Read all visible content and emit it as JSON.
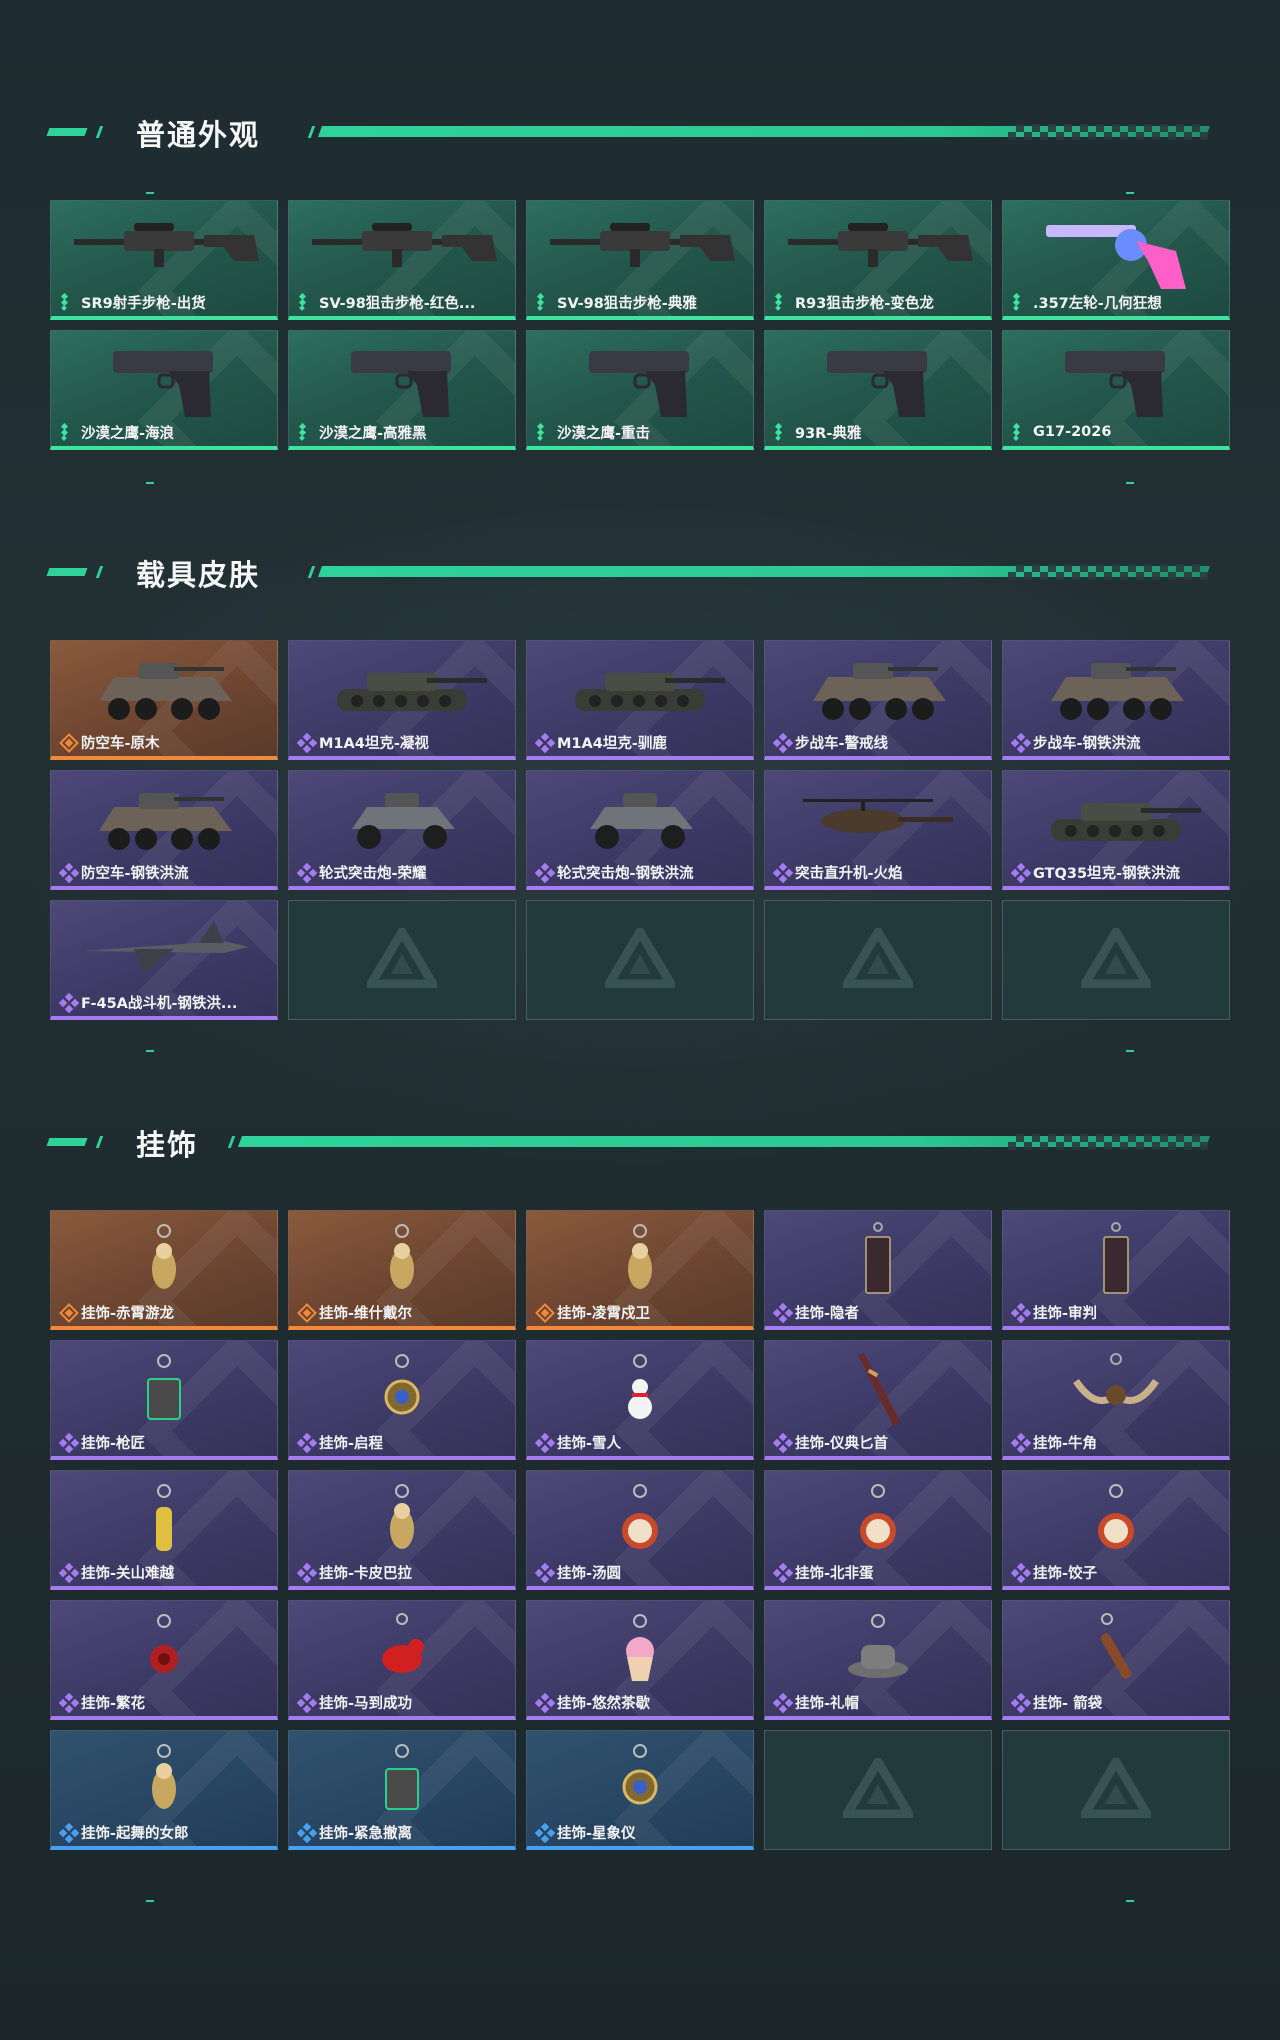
{
  "sections": {
    "weapon": {
      "title": "普通外观",
      "items": [
        {
          "label": "SR9射手步枪-出货",
          "icon": "sniper-rifle-icon"
        },
        {
          "label": "SV-98狙击步枪-红色...",
          "icon": "sniper-rifle-icon"
        },
        {
          "label": "SV-98狙击步枪-典雅",
          "icon": "sniper-rifle-icon"
        },
        {
          "label": "R93狙击步枪-变色龙",
          "icon": "sniper-rifle-icon"
        },
        {
          "label": ".357左轮-几何狂想",
          "icon": "revolver-icon"
        },
        {
          "label": "沙漠之鹰-海浪",
          "icon": "pistol-icon"
        },
        {
          "label": "沙漠之鹰-高雅黑",
          "icon": "pistol-icon"
        },
        {
          "label": "沙漠之鹰-重击",
          "icon": "pistol-icon"
        },
        {
          "label": "93R-典雅",
          "icon": "pistol-icon"
        },
        {
          "label": "G17-2026",
          "icon": "pistol-icon"
        }
      ]
    },
    "vehicle": {
      "title": "载具皮肤",
      "items": [
        {
          "label": "防空车-原木",
          "rarity": "gold",
          "icon": "armored-vehicle-icon"
        },
        {
          "label": "M1A4坦克-凝视",
          "rarity": "purple",
          "icon": "tank-icon"
        },
        {
          "label": "M1A4坦克-驯鹿",
          "rarity": "purple",
          "icon": "tank-icon"
        },
        {
          "label": "步战车-警戒线",
          "rarity": "purple",
          "icon": "armored-vehicle-icon"
        },
        {
          "label": "步战车-钢铁洪流",
          "rarity": "purple",
          "icon": "armored-vehicle-icon"
        },
        {
          "label": "防空车-钢铁洪流",
          "rarity": "purple",
          "icon": "armored-vehicle-icon"
        },
        {
          "label": "轮式突击炮-荣耀",
          "rarity": "purple",
          "icon": "buggy-icon"
        },
        {
          "label": "轮式突击炮-钢铁洪流",
          "rarity": "purple",
          "icon": "buggy-icon"
        },
        {
          "label": "突击直升机-火焰",
          "rarity": "purple",
          "icon": "helicopter-icon"
        },
        {
          "label": "GTQ35坦克-钢铁洪流",
          "rarity": "purple",
          "icon": "tank-icon"
        },
        {
          "label": "F-45A战斗机-钢铁洪...",
          "rarity": "purple",
          "icon": "jet-icon"
        }
      ]
    },
    "charm": {
      "title": "挂饰",
      "items": [
        {
          "label": "挂饰-赤霄游龙",
          "rarity": "gold",
          "icon": "charm-figure-icon"
        },
        {
          "label": "挂饰-维什戴尔",
          "rarity": "gold",
          "icon": "charm-figure-icon"
        },
        {
          "label": "挂饰-凌霄戍卫",
          "rarity": "gold",
          "icon": "charm-figure-icon"
        },
        {
          "label": "挂饰-隐者",
          "rarity": "purple",
          "icon": "charm-card-icon"
        },
        {
          "label": "挂饰-审判",
          "rarity": "purple",
          "icon": "charm-card-icon"
        },
        {
          "label": "挂饰-枪匠",
          "rarity": "purple",
          "icon": "charm-box-icon"
        },
        {
          "label": "挂饰-启程",
          "rarity": "purple",
          "icon": "charm-medal-icon"
        },
        {
          "label": "挂饰-雪人",
          "rarity": "purple",
          "icon": "charm-snowman-icon"
        },
        {
          "label": "挂饰-仪典匕首",
          "rarity": "purple",
          "icon": "charm-dagger-icon"
        },
        {
          "label": "挂饰-牛角",
          "rarity": "purple",
          "icon": "charm-horns-icon"
        },
        {
          "label": "挂饰-关山难越",
          "rarity": "purple",
          "icon": "charm-scroll-icon"
        },
        {
          "label": "挂饰-卡皮巴拉",
          "rarity": "purple",
          "icon": "charm-figure-icon"
        },
        {
          "label": "挂饰-汤圆",
          "rarity": "purple",
          "icon": "charm-bowl-icon"
        },
        {
          "label": "挂饰-北非蛋",
          "rarity": "purple",
          "icon": "charm-bowl-icon"
        },
        {
          "label": "挂饰-饺子",
          "rarity": "purple",
          "icon": "charm-bowl-icon"
        },
        {
          "label": "挂饰-繁花",
          "rarity": "purple",
          "icon": "charm-flower-icon"
        },
        {
          "label": "挂饰-马到成功",
          "rarity": "purple",
          "icon": "charm-horse-icon"
        },
        {
          "label": "挂饰-悠然茶歇",
          "rarity": "purple",
          "icon": "charm-cupcake-icon"
        },
        {
          "label": "挂饰-礼帽",
          "rarity": "purple",
          "icon": "charm-hat-icon"
        },
        {
          "label": "挂饰- 箭袋",
          "rarity": "purple",
          "icon": "charm-quiver-icon"
        },
        {
          "label": "挂饰-起舞的女郎",
          "rarity": "blue",
          "icon": "charm-figure-icon"
        },
        {
          "label": "挂饰-紧急撤离",
          "rarity": "blue",
          "icon": "charm-box-icon"
        },
        {
          "label": "挂饰-星象仪",
          "rarity": "blue",
          "icon": "charm-medal-icon"
        }
      ]
    }
  },
  "colors": {
    "accent": "#2fd39a",
    "green_rarity": "#3fe3a0",
    "gold_rarity": "#f08a3a",
    "purple_rarity": "#a47cf0",
    "blue_rarity": "#4aa0f0"
  }
}
